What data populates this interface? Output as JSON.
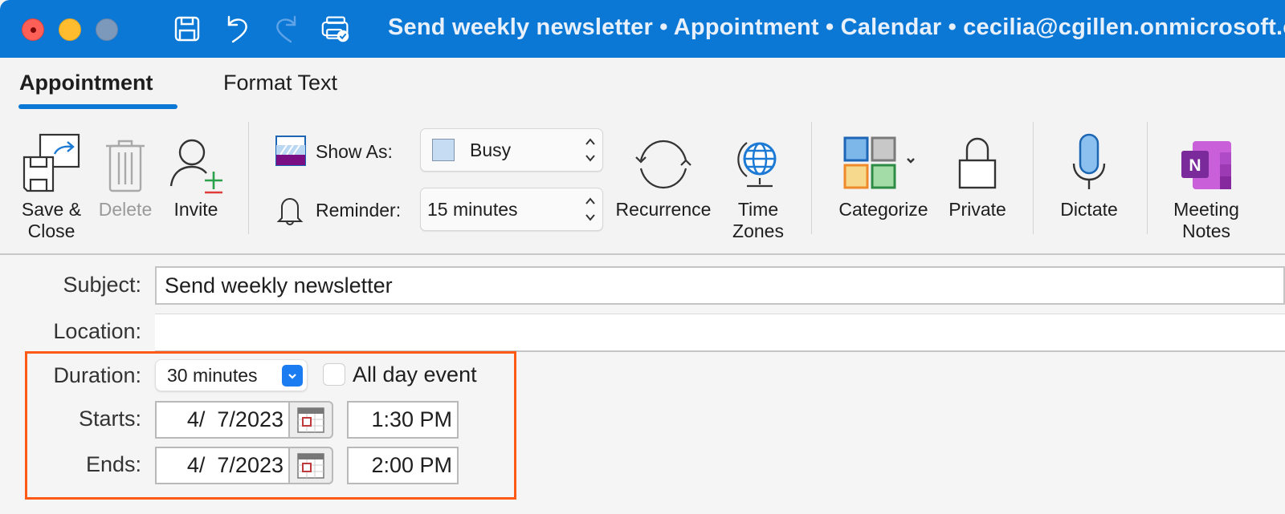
{
  "window": {
    "title": "Send weekly newsletter • Appointment • Calendar • cecilia@cgillen.onmicrosoft.com",
    "accent_color": "#0b78d6",
    "quick_access": [
      {
        "icon": "save-icon",
        "enabled": true
      },
      {
        "icon": "undo-icon",
        "enabled": true
      },
      {
        "icon": "redo-icon",
        "enabled": false
      },
      {
        "icon": "print-icon",
        "enabled": true
      }
    ]
  },
  "tabs": [
    {
      "label": "Appointment",
      "active": true
    },
    {
      "label": "Format Text",
      "active": false
    }
  ],
  "ribbon": {
    "save_close": "Save &\nClose",
    "delete": "Delete",
    "invite": "Invite",
    "show_as": {
      "label": "Show As:",
      "value": "Busy"
    },
    "reminder": {
      "label": "Reminder:",
      "value": "15 minutes"
    },
    "recurrence": "Recurrence",
    "time_zones": "Time\nZones",
    "categorize": "Categorize",
    "private": "Private",
    "dictate": "Dictate",
    "meeting_notes": "Meeting\nNotes"
  },
  "form": {
    "subject": {
      "label": "Subject:",
      "value": "Send weekly newsletter"
    },
    "location": {
      "label": "Location:",
      "value": ""
    },
    "duration": {
      "label": "Duration:",
      "value": "30 minutes"
    },
    "all_day": {
      "label": "All day event",
      "checked": false
    },
    "starts": {
      "label": "Starts:",
      "date": "4/  7/2023",
      "time": "1:30 PM"
    },
    "ends": {
      "label": "Ends:",
      "date": "4/  7/2023",
      "time": "2:00 PM"
    },
    "highlight_color": "#fe5a16"
  }
}
